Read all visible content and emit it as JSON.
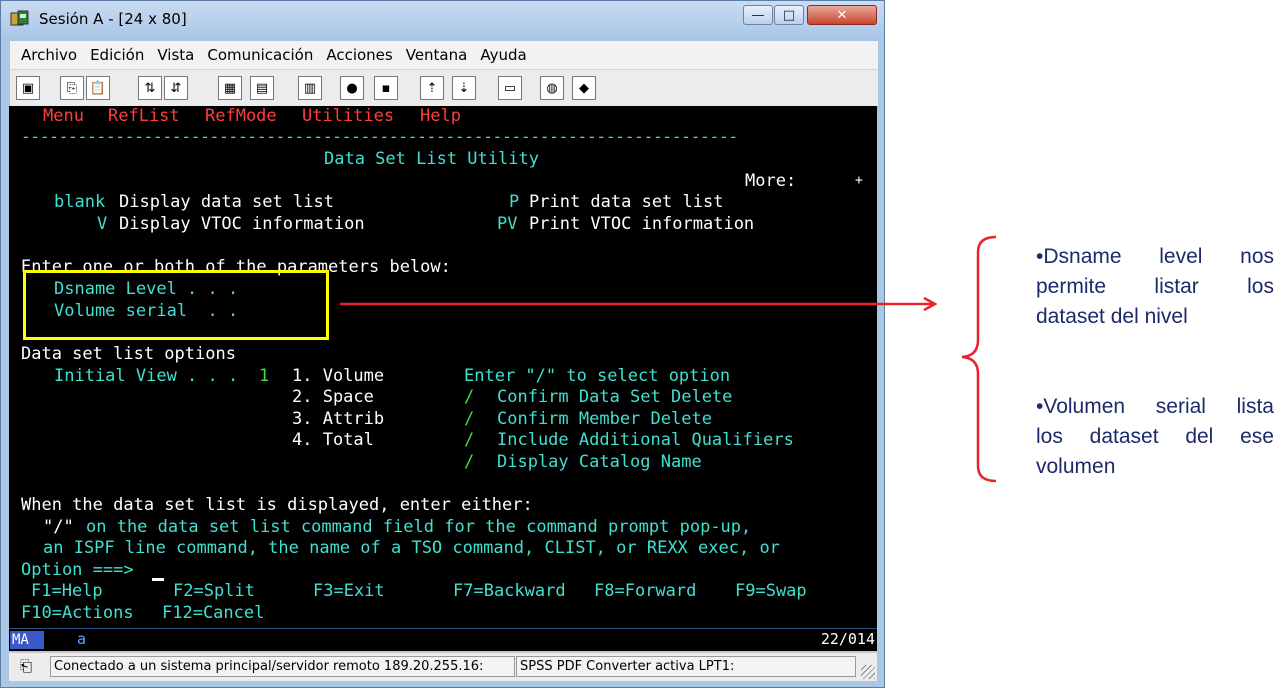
{
  "window": {
    "title": "Sesión A - [24 x 80]",
    "controls": {
      "minimize": "—",
      "maximize": "□",
      "close": "✕"
    }
  },
  "menubar": [
    "Archivo",
    "Edición",
    "Vista",
    "Comunicación",
    "Acciones",
    "Ventana",
    "Ayuda"
  ],
  "toolbar_icons": [
    "print-screen-icon",
    "copy-icon",
    "paste-icon",
    "send-file-icon",
    "receive-file-icon",
    "display-setup-icon",
    "keyboard-setup-icon",
    "macro-record-icon",
    "macro-play-icon",
    "macro-stop-icon",
    "transfer-up-icon",
    "transfer-down-icon",
    "clipboard-icon",
    "globe-icon",
    "help-tag-icon"
  ],
  "terminal": {
    "action_bar": [
      "Menu",
      "RefList",
      "RefMode",
      "Utilities",
      "Help"
    ],
    "separator": "----------------------------------------------------------------------------",
    "panel_title": "Data Set List Utility",
    "more_label": "More:",
    "more_indicator": "+",
    "options": [
      {
        "key": "blank",
        "text": "Display data set list"
      },
      {
        "key": "V",
        "text": "Display VTOC information"
      },
      {
        "key": "P",
        "text": "Print data set list"
      },
      {
        "key": "PV",
        "text": "Print VTOC information"
      }
    ],
    "params_heading": "Enter one or both of the parameters below:",
    "dsname_label": "Dsname Level . . .",
    "volume_label": "Volume serial  . .",
    "list_options_heading": "Data set list options",
    "initial_view_label": "Initial View . . .",
    "initial_view_value": "1",
    "views": [
      "1. Volume",
      "2. Space",
      "3. Attrib",
      "4. Total"
    ],
    "select_hint": "Enter \"/\" to select option",
    "checks": [
      {
        "mark": "/",
        "text": "Confirm Data Set Delete"
      },
      {
        "mark": "/",
        "text": "Confirm Member Delete"
      },
      {
        "mark": "/",
        "text": "Include Additional Qualifiers"
      },
      {
        "mark": "/",
        "text": "Display Catalog Name"
      }
    ],
    "when_displayed": "When the data set list is displayed, enter either:",
    "slash_quote": "\"/\"",
    "slash_desc": "on the data set list command field for the command prompt pop-up,",
    "ispf_desc": "an ISPF line command, the name of a TSO command, CLIST, or REXX exec, or",
    "option_prompt": "Option ===>",
    "fkeys_row1": [
      "F1=Help",
      "F2=Split",
      "F3=Exit",
      "F7=Backward",
      "F8=Forward",
      "F9=Swap"
    ],
    "fkeys_row2": [
      "F10=Actions",
      "F12=Cancel"
    ]
  },
  "oia": {
    "mode": "MA",
    "indicator": "a",
    "cursor_position": "22/014"
  },
  "statusbar": {
    "connection": "Conectado a un sistema principal/servidor remoto 189.20.255.16:",
    "printer": "SPSS PDF Converter activa LPT1:"
  },
  "annotation": {
    "point1": [
      "•Dsname level nos",
      "permite listar los",
      "dataset del nivel"
    ],
    "point2": [
      "•Volumen serial lista",
      "los dataset del ese",
      "volumen"
    ],
    "colors": {
      "highlight_box": "#ffff00",
      "arrow": "#e8232a",
      "text": "#1c2a6b"
    }
  }
}
